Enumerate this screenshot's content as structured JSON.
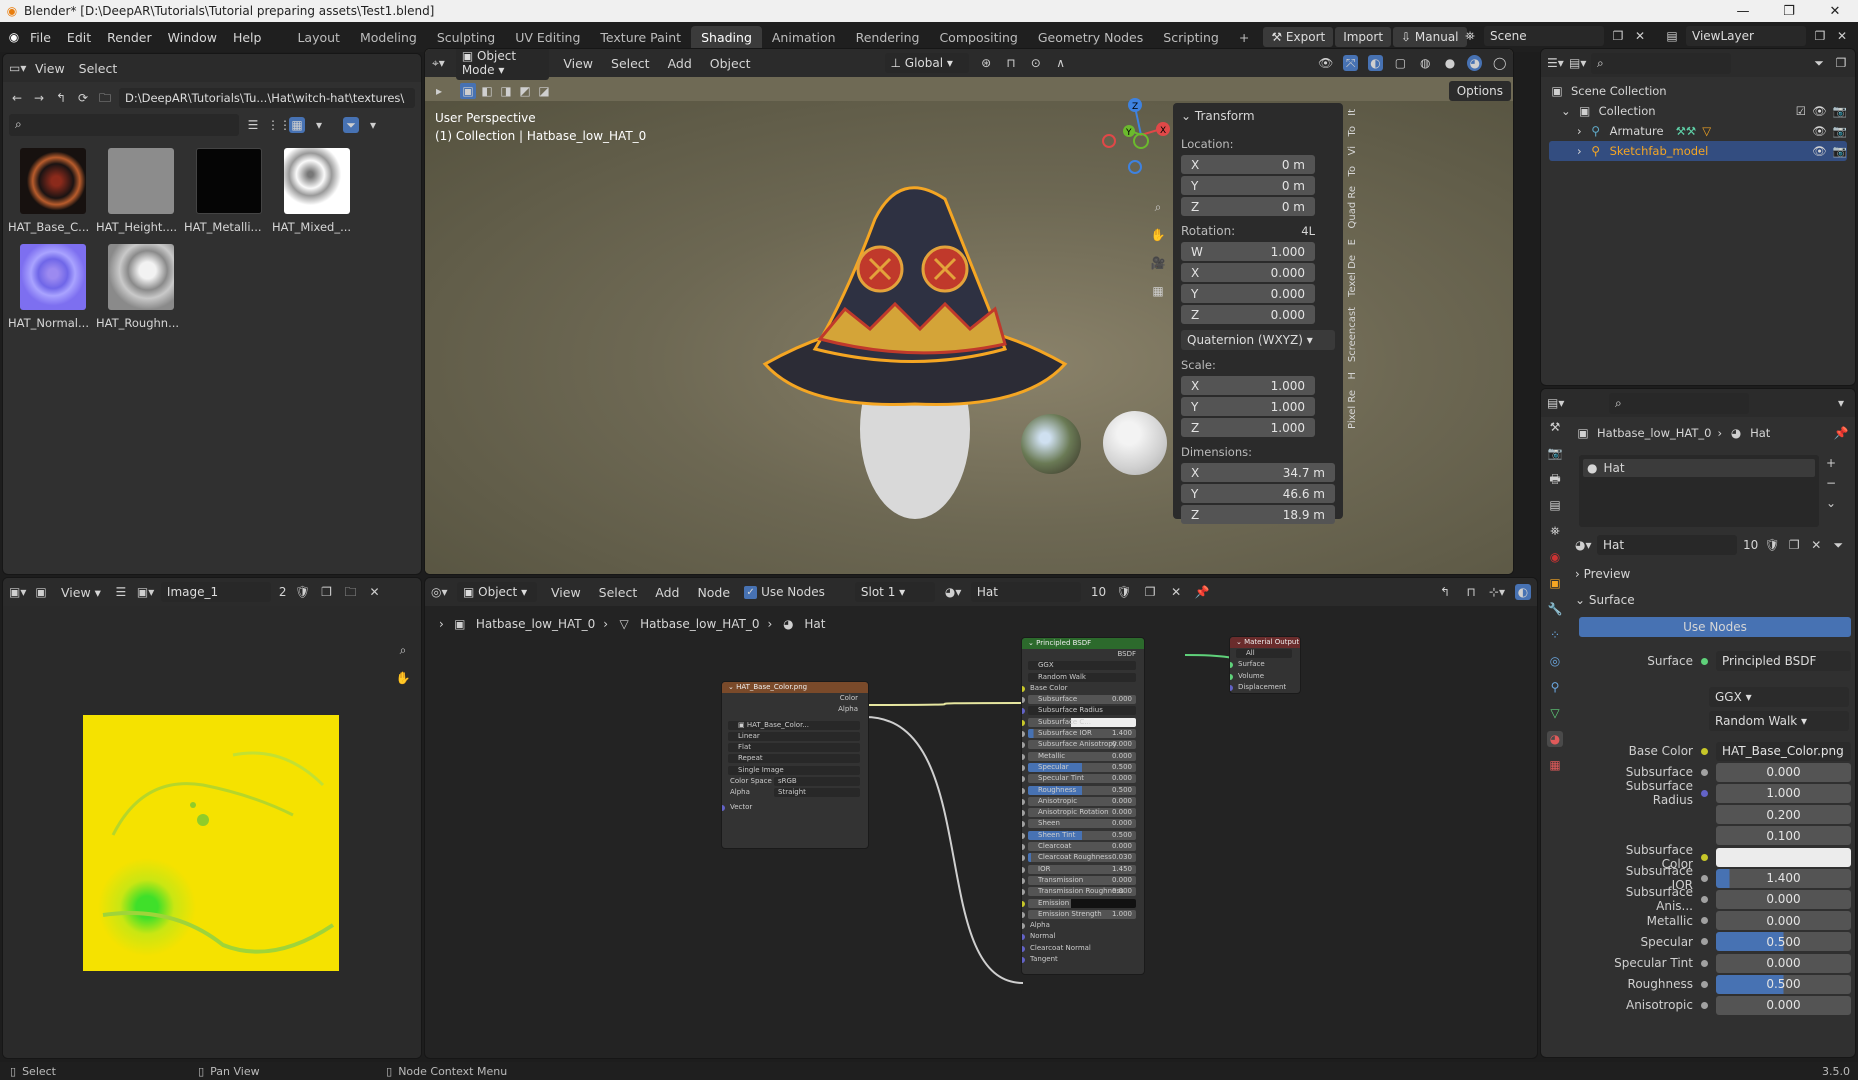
{
  "window": {
    "title": "Blender* [D:\\DeepAR\\Tutorials\\Tutorial preparing assets\\Test1.blend]"
  },
  "menu": [
    "File",
    "Edit",
    "Render",
    "Window",
    "Help"
  ],
  "workspaces": [
    "Layout",
    "Modeling",
    "Sculpting",
    "UV Editing",
    "Texture Paint",
    "Shading",
    "Animation",
    "Rendering",
    "Compositing",
    "Geometry Nodes",
    "Scripting"
  ],
  "top_buttons": {
    "export": "Export",
    "import": "Import",
    "manual": "Manual"
  },
  "scene": {
    "name": "Scene",
    "view_layer": "ViewLayer"
  },
  "file_browser": {
    "view": "View",
    "select": "Select",
    "path": "D:\\DeepAR\\Tutorials\\Tu...\\Hat\\witch-hat\\textures\\",
    "files": [
      "HAT_Base_C...",
      "HAT_Height....",
      "HAT_Metalli...",
      "HAT_Mixed_...",
      "HAT_Normal...",
      "HAT_Roughn..."
    ]
  },
  "viewport": {
    "mode": "Object Mode",
    "view": "View",
    "select": "Select",
    "add": "Add",
    "object": "Object",
    "transform_orient": "Global",
    "options": "Options",
    "perspective": "User Perspective",
    "collection_info": "(1) Collection | Hatbase_low_HAT_0"
  },
  "n_panel": {
    "transform": "Transform",
    "location_label": "Location:",
    "loc": {
      "x": "0 m",
      "y": "0 m",
      "z": "0 m"
    },
    "rotation_label": "Rotation:",
    "rotation_mode_short": "4L",
    "rot": {
      "w": "1.000",
      "x": "0.000",
      "y": "0.000",
      "z": "0.000"
    },
    "rotation_mode": "Quaternion (WXYZ)",
    "scale_label": "Scale:",
    "scale": {
      "x": "1.000",
      "y": "1.000",
      "z": "1.000"
    },
    "dimensions_label": "Dimensions:",
    "dim": {
      "x": "34.7 m",
      "y": "46.6 m",
      "z": "18.9 m"
    },
    "axis": {
      "w": "W",
      "x": "X",
      "y": "Y",
      "z": "Z"
    },
    "side_tabs": [
      "It",
      "To",
      "Vi",
      "To",
      "Quad Re",
      "E",
      "Texel De",
      "Screencast",
      "H",
      "Pixel Re"
    ]
  },
  "outliner": {
    "scene_collection": "Scene Collection",
    "collection": "Collection",
    "armature": "Armature",
    "sketchfab": "Sketchfab_model"
  },
  "image_editor": {
    "view": "View",
    "image": "Image_1",
    "users": "2"
  },
  "node_editor": {
    "object": "Object",
    "view": "View",
    "select": "Select",
    "add": "Add",
    "node": "Node",
    "use_nodes": "Use Nodes",
    "slot": "Slot 1",
    "material": "Hat",
    "users": "10",
    "breadcrumb": [
      "Hatbase_low_HAT_0",
      "Hatbase_low_HAT_0",
      "Hat"
    ],
    "image_node": {
      "title": "HAT_Base_Color.png",
      "out_color": "Color",
      "out_alpha": "Alpha",
      "image": "HAT_Base_Color...",
      "opts": [
        "Linear",
        "Flat",
        "Repeat",
        "Single Image"
      ],
      "color_space_label": "Color Space",
      "color_space": "sRGB",
      "alpha_label": "Alpha",
      "alpha": "Straight",
      "vector": "Vector"
    },
    "bsdf_node": {
      "title": "Principled BSDF",
      "out": "BSDF",
      "dist": "GGX",
      "sss_method": "Random Walk",
      "base_color": "Base Color",
      "rows": [
        {
          "label": "Subsurface",
          "value": "0.000",
          "fill": 0
        },
        {
          "label": "Subsurface Radius",
          "value": "",
          "fill": 0
        },
        {
          "label": "Subsurface C...",
          "value": "",
          "fill": 0
        },
        {
          "label": "Subsurface IOR",
          "value": "1.400",
          "fill": 0.05
        },
        {
          "label": "Subsurface Anisotropy",
          "value": "0.000",
          "fill": 0
        },
        {
          "label": "Metallic",
          "value": "0.000",
          "fill": 0
        },
        {
          "label": "Specular",
          "value": "0.500",
          "fill": 0.5
        },
        {
          "label": "Specular Tint",
          "value": "0.000",
          "fill": 0
        },
        {
          "label": "Roughness",
          "value": "0.500",
          "fill": 0.5
        },
        {
          "label": "Anisotropic",
          "value": "0.000",
          "fill": 0
        },
        {
          "label": "Anisotropic Rotation",
          "value": "0.000",
          "fill": 0
        },
        {
          "label": "Sheen",
          "value": "0.000",
          "fill": 0
        },
        {
          "label": "Sheen Tint",
          "value": "0.500",
          "fill": 0.5
        },
        {
          "label": "Clearcoat",
          "value": "0.000",
          "fill": 0
        },
        {
          "label": "Clearcoat Roughness",
          "value": "0.030",
          "fill": 0.03
        },
        {
          "label": "IOR",
          "value": "1.450",
          "fill": 0
        },
        {
          "label": "Transmission",
          "value": "0.000",
          "fill": 0
        },
        {
          "label": "Transmission Roughness",
          "value": "0.000",
          "fill": 0
        },
        {
          "label": "Emission",
          "value": "",
          "fill": 0
        },
        {
          "label": "Emission Strength",
          "value": "1.000",
          "fill": 0
        }
      ],
      "inputs_tail": [
        "Alpha",
        "Normal",
        "Clearcoat Normal",
        "Tangent"
      ]
    },
    "output_node": {
      "title": "Material Output",
      "target": "All",
      "inputs": [
        "Surface",
        "Volume",
        "Displacement"
      ]
    }
  },
  "properties": {
    "object": "Hatbase_low_HAT_0",
    "material": "Hat",
    "slot_item": "Hat",
    "mat_users": "10",
    "preview": "Preview",
    "surface": "Surface",
    "use_nodes": "Use Nodes",
    "surface_label": "Surface",
    "surface_val": "Principled BSDF",
    "dist": "GGX",
    "sss": "Random Walk",
    "rows": [
      {
        "label": "Base Color",
        "value": "HAT_Base_Color.png"
      },
      {
        "label": "Subsurface",
        "value": "0.000"
      },
      {
        "label": "Subsurface Radius",
        "value": "1.000"
      },
      {
        "label": "",
        "value": "0.200"
      },
      {
        "label": "",
        "value": "0.100"
      },
      {
        "label": "Subsurface Color",
        "value": ""
      },
      {
        "label": "Subsurface IOR",
        "value": "1.400"
      },
      {
        "label": "Subsurface Anis...",
        "value": "0.000"
      },
      {
        "label": "Metallic",
        "value": "0.000"
      },
      {
        "label": "Specular",
        "value": "0.500"
      },
      {
        "label": "Specular Tint",
        "value": "0.000"
      },
      {
        "label": "Roughness",
        "value": "0.500"
      },
      {
        "label": "Anisotropic",
        "value": "0.000"
      }
    ]
  },
  "status": {
    "select": "Select",
    "pan": "Pan View",
    "node_menu": "Node Context Menu",
    "version": "3.5.0"
  },
  "colors": {
    "accent": "#4772b3",
    "header": "#2b2b2b",
    "panel": "#303030",
    "orange": "#f5a623"
  }
}
